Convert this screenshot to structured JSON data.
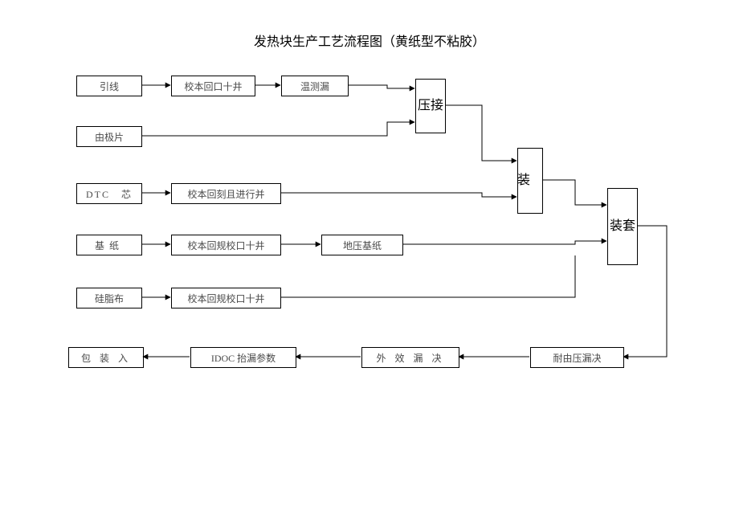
{
  "title": "发热块生产工艺流程图（黄纸型不粘胶）",
  "nodes": {
    "n1_1": "引线",
    "n1_2": "校本回口十井",
    "n1_3": "温测漏",
    "n2_1": "由极片",
    "n3_1": "DTC 芯",
    "n3_2": "校本回刻且进行并",
    "n4_1": "基纸",
    "n4_2": "校本回规校口十井",
    "n4_3": "地压基纸",
    "n5_1": "硅脂布",
    "n5_2": "校本回规校口十井",
    "v1": "压接",
    "v2": "装 ",
    "v3": "装套",
    "b1": "耐由压漏决",
    "b2": "外 效 漏 决",
    "b3": "IDOC 抬漏参数",
    "b4": "包 装 入"
  }
}
